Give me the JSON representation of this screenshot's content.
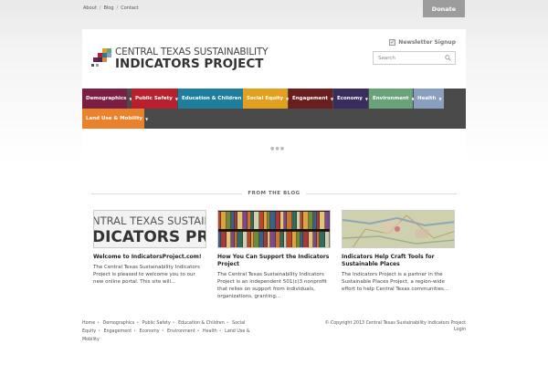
{
  "topbar": {
    "links": [
      "About",
      "Blog",
      "Contact"
    ],
    "donate_label": "Donate"
  },
  "header": {
    "logo_line1": "CENTRAL TEXAS SUSTAINABILITY",
    "logo_line2": "INDICATORS PROJECT",
    "newsletter_label": "Newsletter Signup",
    "search_placeholder": "Search"
  },
  "nav": {
    "items": [
      {
        "label": "Demographics",
        "color": "#7b1e46"
      },
      {
        "label": "Public Safety",
        "color": "#b8202f"
      },
      {
        "label": "Education & Children",
        "color": "#1d7e9e"
      },
      {
        "label": "Social Equity",
        "color": "#e2a01e"
      },
      {
        "label": "Engagement",
        "color": "#6b1e1e"
      },
      {
        "label": "Economy",
        "color": "#3a2c5c"
      },
      {
        "label": "Environment",
        "color": "#6aa37a"
      },
      {
        "label": "Health",
        "color": "#8a9ec0"
      },
      {
        "label": "Land Use & Mobility",
        "color": "#e9822a"
      }
    ]
  },
  "carousel_dots": "●●●",
  "blog": {
    "section_label": "FROM THE BLOG",
    "posts": [
      {
        "thumb_line1": "NTRAL TEXAS SUSTAIN",
        "thumb_line2": "DICATORS PRO",
        "title": "Welcome to IndicatorsProject.com!",
        "excerpt": "The Central Texas Sustainability Indicators Project is pleased to welcome you to our new online portal. This site will..."
      },
      {
        "title": "How You Can Support the Indicators Project",
        "excerpt": "The Central Texas Sustainability Indicators Project is an independent 501(c)3 nonprofit that relies on support from individuals, organizations, granting..."
      },
      {
        "title": "Indicators Help Craft Tools for Sustainable Places",
        "excerpt": "The Indicators Project is a partner in the Sustainable Places Project, a region-wide effort to help Central Texas communities..."
      }
    ]
  },
  "footer": {
    "links": [
      "Home",
      "Demographics",
      "Public Safety",
      "Education & Children",
      "Social Equity",
      "Engagement",
      "Economy",
      "Environment",
      "Health",
      "Land Use & Mobility"
    ],
    "copyright": "© Copyright 2013 Central Texas Sustainability Indicators Project",
    "login": "Login"
  }
}
